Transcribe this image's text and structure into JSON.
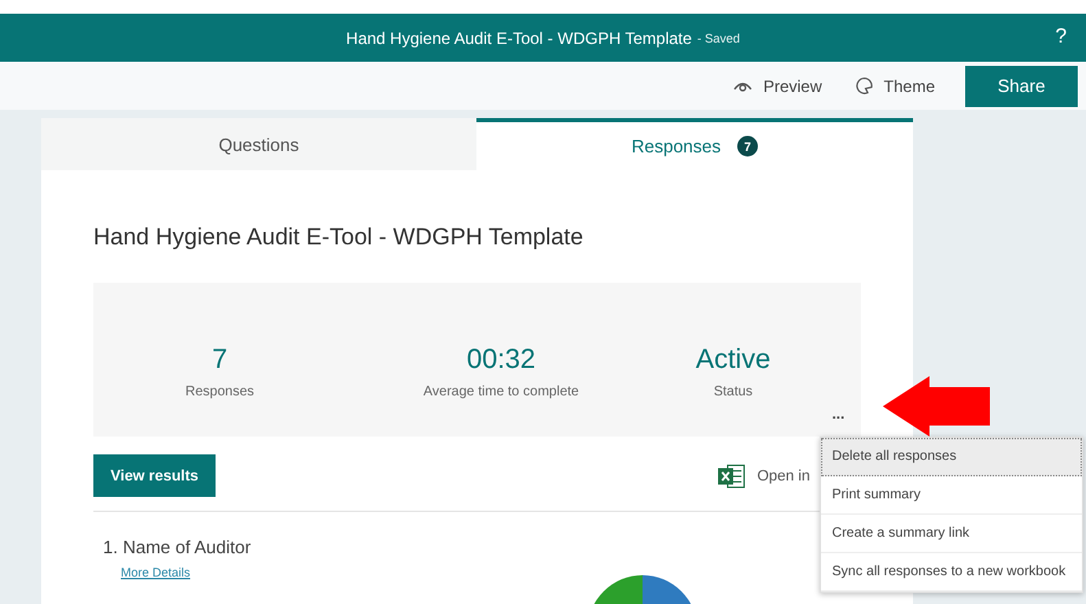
{
  "window": {
    "title": "Hand Hygiene Audit E-Tool - WDGPH Template",
    "save_status": "- Saved",
    "help": "?"
  },
  "toolbar": {
    "buttons": [
      {
        "kind": "preview",
        "label": "Preview"
      },
      {
        "kind": "theme",
        "label": "Theme"
      },
      {
        "kind": "share",
        "label": "Share"
      }
    ]
  },
  "tabs": [
    {
      "label": "Questions",
      "selected": false
    },
    {
      "label": "Responses",
      "selected": true,
      "badge": "7"
    }
  ],
  "form_title": "Hand Hygiene Audit E-Tool - WDGPH Template",
  "stats": [
    {
      "value": "7",
      "label": "Responses"
    },
    {
      "value": "00:32",
      "label": "Average time to complete"
    },
    {
      "value": "Active",
      "label": "Status"
    }
  ],
  "more": "...",
  "view_results": "View results",
  "open_in_excel": "Open in",
  "questions": [
    {
      "number": "1.",
      "title": "Name of Auditor",
      "link": "More Details"
    }
  ],
  "menu": [
    {
      "label": "Delete all responses",
      "highlighted": true
    },
    {
      "label": "Print summary",
      "highlighted": false
    },
    {
      "label": "Create a summary link",
      "highlighted": false
    },
    {
      "label": "Sync all responses to a new workbook",
      "highlighted": false
    }
  ]
}
